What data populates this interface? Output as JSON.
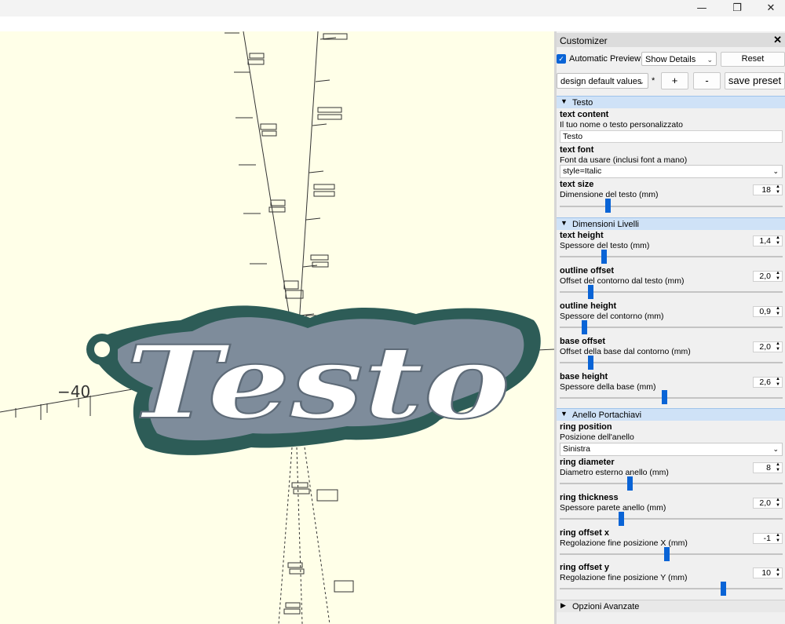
{
  "window": {
    "minimize_icon": "minimize-icon",
    "maximize_icon": "restore-icon",
    "close_icon": "close-icon"
  },
  "viewport": {
    "axis_label": "−40",
    "model_text": "Testo",
    "colors": {
      "base": "#2d5c57",
      "outline": "#7e8c9b",
      "text": "#ffffff",
      "background": "#ffffe8"
    }
  },
  "customizer": {
    "title": "Customizer",
    "automatic_preview": "Automatic Preview",
    "automatic_preview_checked": true,
    "details_mode": "Show Details",
    "reset": "Reset",
    "preset": "design default values",
    "preset_modified": "*",
    "add_preset": "+",
    "remove_preset": "-",
    "save_preset": "save preset",
    "sections": {
      "testo": {
        "title": "Testo",
        "text_content": {
          "name": "text content",
          "desc": "Il tuo nome o testo personalizzato",
          "value": "Testo"
        },
        "text_font": {
          "name": "text font",
          "desc": "Font da usare (inclusi font a mano)",
          "value": "style=Italic"
        },
        "text_size": {
          "name": "text size",
          "desc": "Dimensione del testo (mm)",
          "value": "18",
          "slider": 0.21
        }
      },
      "dimensioni": {
        "title": "Dimensioni Livelli",
        "text_height": {
          "name": "text height",
          "desc": "Spessore del testo (mm)",
          "value": "1,4",
          "slider": 0.19
        },
        "outline_offset": {
          "name": "outline offset",
          "desc": "Offset del contorno dal testo (mm)",
          "value": "2,0",
          "slider": 0.13
        },
        "outline_height": {
          "name": "outline height",
          "desc": "Spessore del contorno (mm)",
          "value": "0,9",
          "slider": 0.1
        },
        "base_offset": {
          "name": "base offset",
          "desc": "Offset della base dal contorno (mm)",
          "value": "2,0",
          "slider": 0.13
        },
        "base_height": {
          "name": "base height",
          "desc": "Spessore della base (mm)",
          "value": "2,6",
          "slider": 0.47
        }
      },
      "anello": {
        "title": "Anello Portachiavi",
        "ring_position": {
          "name": "ring position",
          "desc": "Posizione dell'anello",
          "value": "Sinistra"
        },
        "ring_diameter": {
          "name": "ring diameter",
          "desc": "Diametro esterno anello (mm)",
          "value": "8",
          "slider": 0.31
        },
        "ring_thickness": {
          "name": "ring thickness",
          "desc": "Spessore parete anello (mm)",
          "value": "2,0",
          "slider": 0.27
        },
        "ring_offset_x": {
          "name": "ring offset x",
          "desc": "Regolazione fine posizione X (mm)",
          "value": "-1",
          "slider": 0.48
        },
        "ring_offset_y": {
          "name": "ring offset y",
          "desc": "Regolazione fine posizione Y (mm)",
          "value": "10",
          "slider": 0.74
        }
      },
      "avanzate": {
        "title": "Opzioni Avanzate"
      }
    }
  }
}
